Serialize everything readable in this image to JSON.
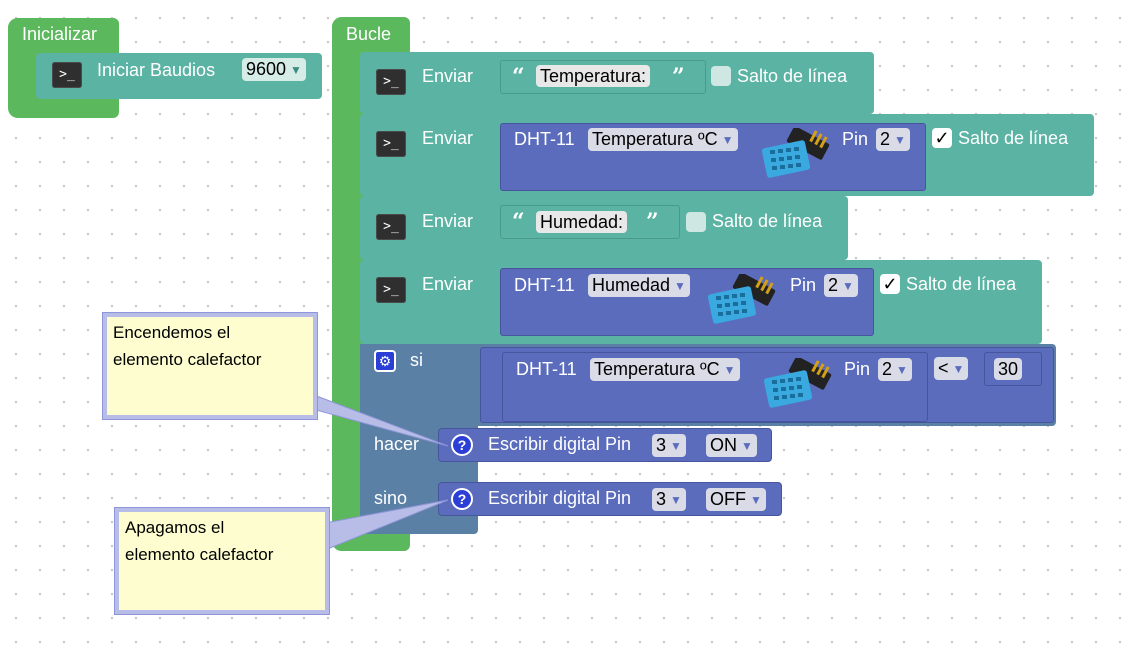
{
  "setup": {
    "title": "Inicializar",
    "serial": {
      "label": "Iniciar  Baudios",
      "baud": "9600",
      "icon": "terminal-icon"
    }
  },
  "loop": {
    "title": "Bucle",
    "send1": {
      "label": "Enviar",
      "text": "Temperatura:",
      "newline_label": "Salto de línea",
      "newline_checked": false
    },
    "send2": {
      "label": "Enviar",
      "sensor": "DHT-11",
      "measure": "Temperatura ºC",
      "pin_label": "Pin",
      "pin": "2",
      "newline_label": "Salto de línea",
      "newline_checked": true
    },
    "send3": {
      "label": "Enviar",
      "text": "Humedad:",
      "newline_label": "Salto de línea",
      "newline_checked": false
    },
    "send4": {
      "label": "Enviar",
      "sensor": "DHT-11",
      "measure": "Humedad",
      "pin_label": "Pin",
      "pin": "2",
      "newline_label": "Salto de línea",
      "newline_checked": true
    },
    "if_block": {
      "if_label": "si",
      "sensor": "DHT-11",
      "measure": "Temperatura ºC",
      "pin_label": "Pin",
      "pin": "2",
      "operator": "<",
      "value": "30",
      "do_label": "hacer",
      "do_action": {
        "label": "Escribir digital Pin",
        "pin": "3",
        "state": "ON"
      },
      "else_label": "sino",
      "else_action": {
        "label": "Escribir digital Pin",
        "pin": "3",
        "state": "OFF"
      }
    }
  },
  "comments": {
    "on": "Encendemos el\nelemento calefactor",
    "off": "Apagamos el\nelemento calefactor"
  },
  "colors": {
    "green": "#5cb85c",
    "teal": "#5bb3a3",
    "blue": "#5b6cbc",
    "if": "#5b80a5"
  }
}
